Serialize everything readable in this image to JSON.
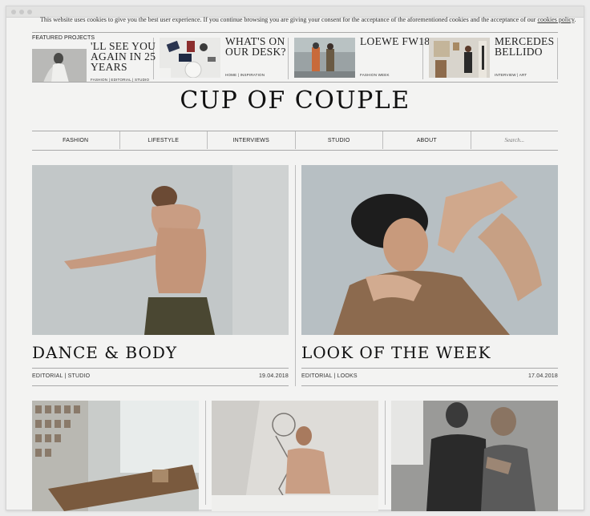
{
  "cookie": {
    "text": "This website uses cookies to give you the best user experience. If you continue browsing you are giving your consent for the acceptance of the aforementioned cookies and the acceptance of our ",
    "link": "cookies policy",
    "end": "."
  },
  "featured": {
    "label": "FEATURED PROJECTS",
    "items": [
      {
        "title_line1": "'LL SEE YOU",
        "title_line2": "AGAIN IN 25",
        "title_line3": "YEARS",
        "tags": "FASHION | EDITORIAL | STUDIO"
      },
      {
        "title_line1": "WHAT'S ON",
        "title_line2": "OUR DESK?",
        "title_line3": "",
        "tags": "HOME | INSPIRATION"
      },
      {
        "title_line1": "LOEWE FW18",
        "title_line2": "",
        "title_line3": "",
        "tags": "FASHION WEEK"
      },
      {
        "title_line1": "MERCEDES",
        "title_line2": "BELLIDO",
        "title_line3": "",
        "tags": "INTERVIEW | ART"
      }
    ]
  },
  "logo": "CUP OF COUPLE",
  "nav": {
    "items": [
      "FASHION",
      "LIFESTYLE",
      "INTERVIEWS",
      "STUDIO",
      "ABOUT"
    ],
    "search_placeholder": "Search..."
  },
  "articles": [
    {
      "title": "DANCE & BODY",
      "tags": "EDITORIAL | STUDIO",
      "date": "19.04.2018"
    },
    {
      "title": "LOOK OF THE WEEK",
      "tags": "EDITORIAL | LOOKS",
      "date": "17.04.2018"
    }
  ],
  "colors": {
    "background": "#f3f3f2",
    "text": "#222222",
    "rule": "#a9a9a9"
  }
}
